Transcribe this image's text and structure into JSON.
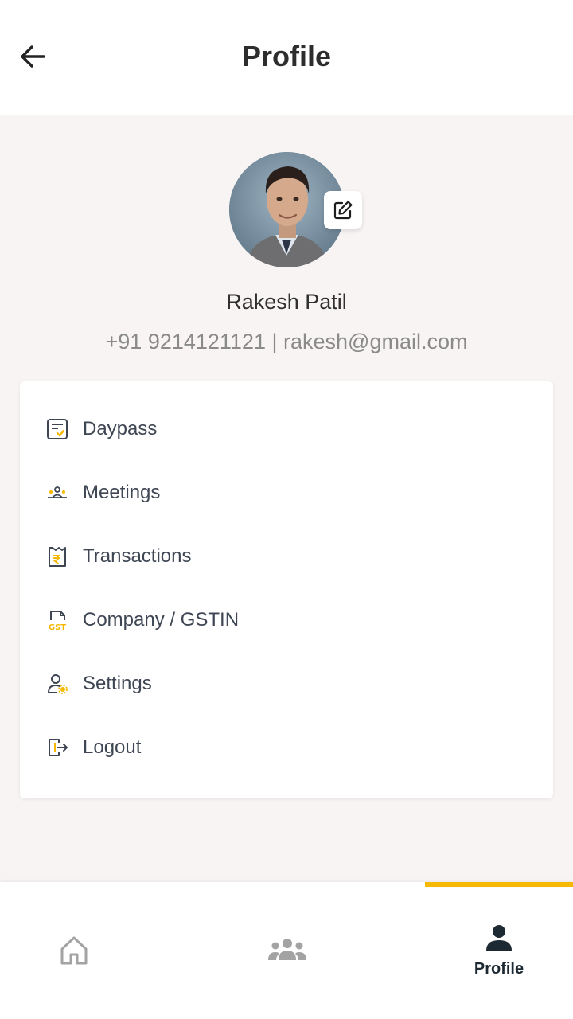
{
  "header": {
    "title": "Profile",
    "back_icon": "arrow-left-icon"
  },
  "profile": {
    "name": "Rakesh Patil",
    "contact": "+91 9214121121 | rakesh@gmail.com",
    "edit_icon": "edit-icon"
  },
  "menu": {
    "items": [
      {
        "label": "Daypass",
        "icon": "daypass-icon"
      },
      {
        "label": "Meetings",
        "icon": "meetings-icon"
      },
      {
        "label": "Transactions",
        "icon": "transactions-icon"
      },
      {
        "label": "Company / GSTIN",
        "icon": "gst-icon"
      },
      {
        "label": "Settings",
        "icon": "settings-user-icon"
      },
      {
        "label": "Logout",
        "icon": "logout-icon"
      }
    ]
  },
  "bottom_nav": {
    "items": [
      {
        "label": "",
        "icon": "home-icon"
      },
      {
        "label": "",
        "icon": "community-icon"
      },
      {
        "label": "Profile",
        "icon": "profile-icon"
      }
    ],
    "active_index": 2
  },
  "colors": {
    "accent": "#f6b800",
    "text_primary": "#2d2d2d",
    "text_secondary": "#8a8a8a",
    "background": "#f7f4f3"
  },
  "gst_icon_text": "GST"
}
